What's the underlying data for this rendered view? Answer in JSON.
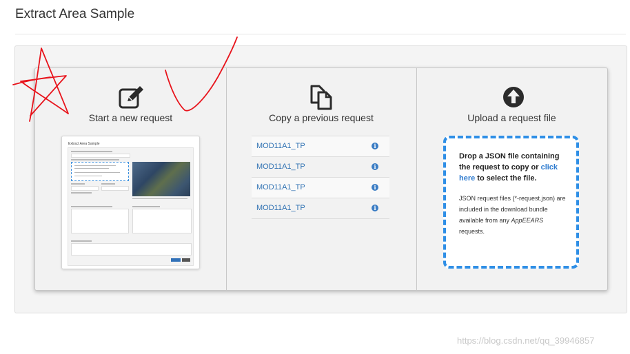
{
  "page": {
    "title": "Extract Area Sample"
  },
  "new_request": {
    "title": "Start a new request",
    "icon": "edit-icon",
    "thumbnail_title": "Extract Area Sample"
  },
  "copy_request": {
    "title": "Copy a previous request",
    "icon": "copy-icon",
    "items": [
      {
        "label": "MOD11A1_TP"
      },
      {
        "label": "MOD11A1_TP"
      },
      {
        "label": "MOD11A1_TP"
      },
      {
        "label": "MOD11A1_TP"
      }
    ]
  },
  "upload_request": {
    "title": "Upload a request file",
    "icon": "upload-circle-icon",
    "drop_text_1": "Drop a JSON file containing the request to copy or ",
    "drop_link": "click here",
    "drop_text_2": " to select the file.",
    "note_1": "JSON request files (*-request.json) are included in the download bundle available from any ",
    "note_em": "AppEEARS",
    "note_2": " requests."
  },
  "watermark": "https://blog.csdn.net/qq_39946857",
  "colors": {
    "link": "#3072b3",
    "dropzone_border": "#2f8fe6",
    "info_icon": "#3b7dc4",
    "annotation": "#e8141c"
  }
}
